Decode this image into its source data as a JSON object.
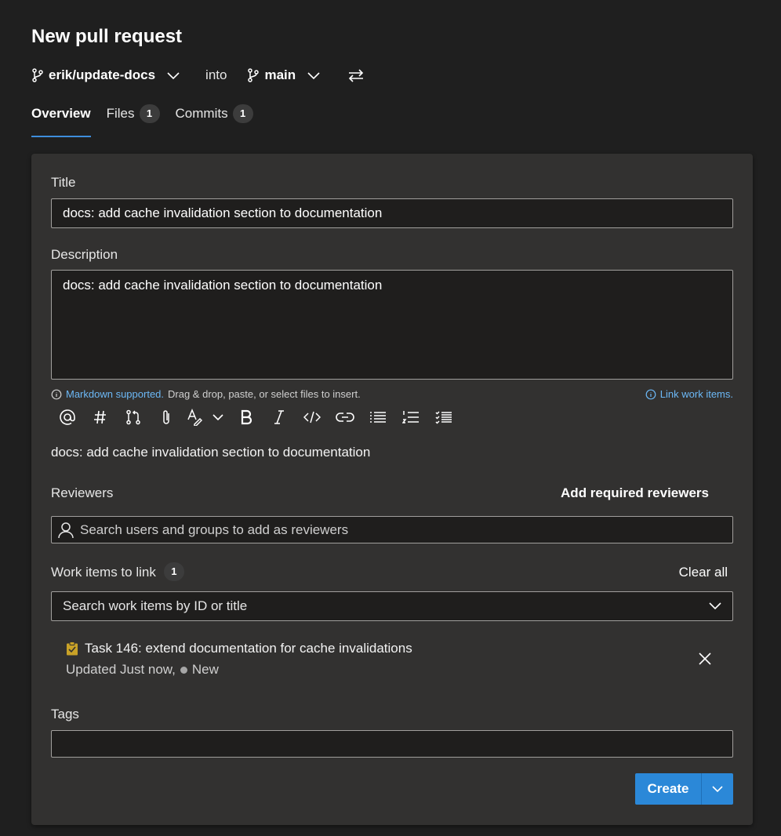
{
  "header": {
    "title": "New pull request",
    "source_branch": "erik/update-docs",
    "into_label": "into",
    "target_branch": "main"
  },
  "tabs": [
    {
      "label": "Overview",
      "count": null,
      "active": true
    },
    {
      "label": "Files",
      "count": "1",
      "active": false
    },
    {
      "label": "Commits",
      "count": "1",
      "active": false
    }
  ],
  "form": {
    "title_label": "Title",
    "title_value": "docs: add cache invalidation section to documentation",
    "description_label": "Description",
    "description_value": "docs: add cache invalidation section to documentation",
    "markdown_link": "Markdown supported.",
    "markdown_hint": "Drag & drop, paste, or select files to insert.",
    "link_work_items": "Link work items.",
    "toolbar": [
      "mention-icon",
      "hash-icon",
      "pull-request-icon",
      "attach-icon",
      "highlight-icon",
      "chevron-down-icon",
      "bold-icon",
      "italic-icon",
      "code-icon",
      "link-icon",
      "bulleted-list-icon",
      "numbered-list-icon",
      "task-list-icon"
    ],
    "preview_text": "docs: add cache invalidation section to documentation"
  },
  "reviewers": {
    "label": "Reviewers",
    "add_required": "Add required reviewers",
    "placeholder": "Search users and groups to add as reviewers"
  },
  "work_items": {
    "label": "Work items to link",
    "count": "1",
    "clear_all": "Clear all",
    "search_placeholder": "Search work items by ID or title",
    "item_title": "Task 146: extend documentation for cache invalidations",
    "item_updated": "Updated Just now,",
    "item_state": "New"
  },
  "tags": {
    "label": "Tags"
  },
  "actions": {
    "create": "Create"
  },
  "colors": {
    "background": "#1f1f1f",
    "card": "#323130",
    "accent": "#2b88d8",
    "link": "#6cb8f6",
    "task_icon": "#c9a227"
  }
}
